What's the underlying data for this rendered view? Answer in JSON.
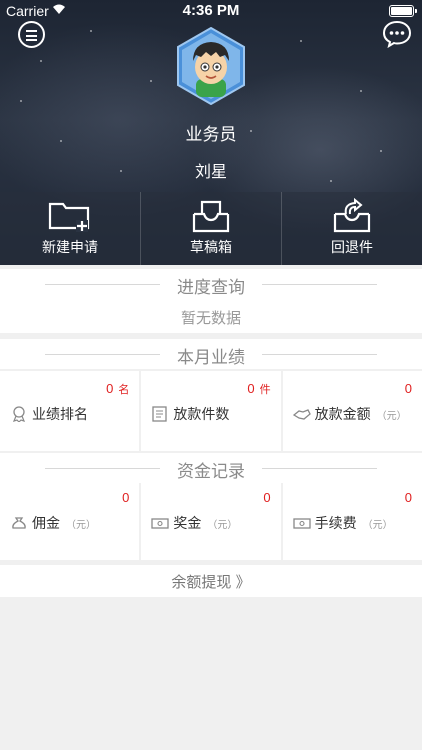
{
  "status_bar": {
    "carrier": "Carrier",
    "time": "4:36 PM"
  },
  "profile": {
    "role": "业务员",
    "name": "刘星"
  },
  "quick_actions": [
    {
      "label": "新建申请",
      "icon": "new-folder-icon"
    },
    {
      "label": "草稿箱",
      "icon": "inbox-icon"
    },
    {
      "label": "回退件",
      "icon": "return-inbox-icon"
    }
  ],
  "progress": {
    "title": "进度查询",
    "empty_text": "暂无数据"
  },
  "performance": {
    "title": "本月业绩",
    "cards": [
      {
        "label": "业绩排名",
        "value": "0",
        "unit": "名",
        "sub": ""
      },
      {
        "label": "放款件数",
        "value": "0",
        "unit": "件",
        "sub": ""
      },
      {
        "label": "放款金额",
        "value": "0",
        "unit": "",
        "sub": "（元）"
      }
    ]
  },
  "funds": {
    "title": "资金记录",
    "cards": [
      {
        "label": "佣金",
        "value": "0",
        "sub": "（元）"
      },
      {
        "label": "奖金",
        "value": "0",
        "sub": "（元）"
      },
      {
        "label": "手续费",
        "value": "0",
        "sub": "（元）"
      }
    ]
  },
  "withdraw": {
    "label": "余额提现 》"
  },
  "colors": {
    "accent_red": "#e02020",
    "hero_bg": "#232c3a"
  }
}
